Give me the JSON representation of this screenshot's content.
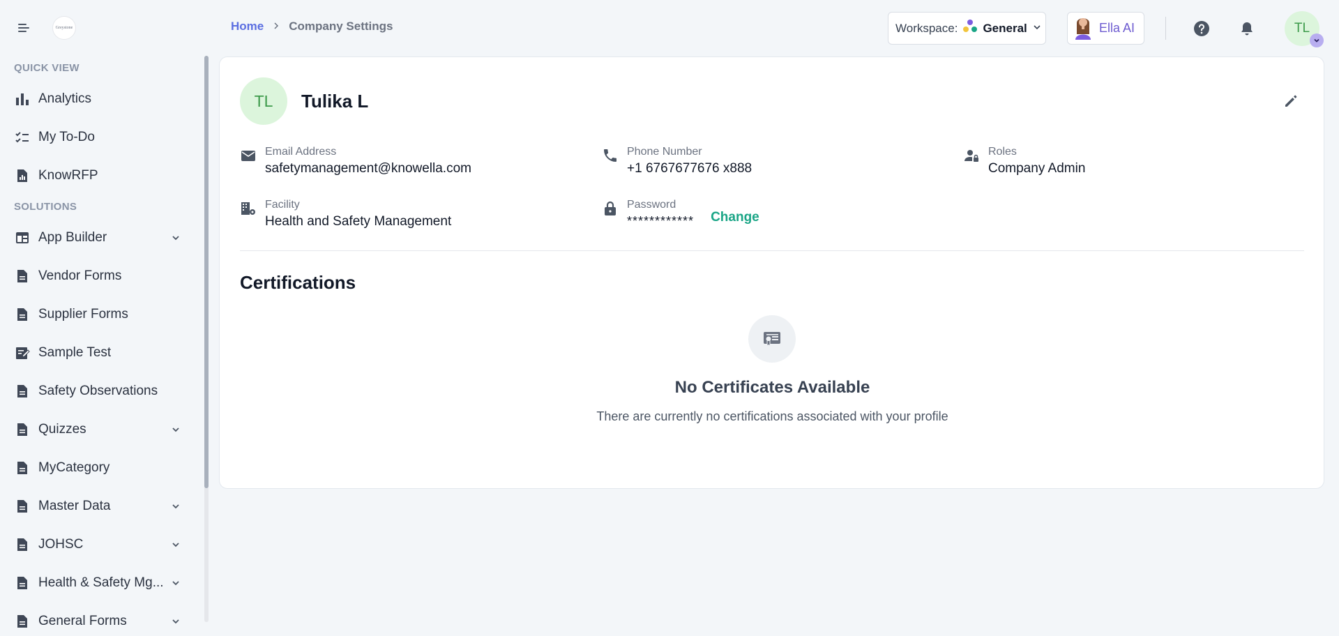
{
  "brand": {
    "logo_text": "Greystone"
  },
  "sidebar": {
    "sections": [
      {
        "title": "QUICK VIEW"
      },
      {
        "title": "SOLUTIONS"
      }
    ],
    "quick_view": [
      {
        "label": "Analytics",
        "icon": "bar-chart-icon"
      },
      {
        "label": "My To-Do",
        "icon": "checklist-icon"
      },
      {
        "label": "KnowRFP",
        "icon": "document-chart-icon"
      }
    ],
    "solutions": [
      {
        "label": "App Builder",
        "icon": "app-builder-icon",
        "expandable": true
      },
      {
        "label": "Vendor Forms",
        "icon": "document-icon",
        "expandable": false
      },
      {
        "label": "Supplier Forms",
        "icon": "document-icon",
        "expandable": false
      },
      {
        "label": "Sample Test",
        "icon": "edit-document-icon",
        "expandable": false
      },
      {
        "label": "Safety Observations",
        "icon": "document-icon",
        "expandable": false
      },
      {
        "label": "Quizzes",
        "icon": "document-icon",
        "expandable": true
      },
      {
        "label": "MyCategory",
        "icon": "document-icon",
        "expandable": false
      },
      {
        "label": "Master Data",
        "icon": "document-icon",
        "expandable": true
      },
      {
        "label": "JOHSC",
        "icon": "document-icon",
        "expandable": true
      },
      {
        "label": "Health & Safety Mg...",
        "icon": "document-icon",
        "expandable": true
      },
      {
        "label": "General Forms",
        "icon": "document-icon",
        "expandable": true
      }
    ]
  },
  "header": {
    "breadcrumb": {
      "home": "Home",
      "current": "Company Settings"
    },
    "workspace": {
      "label": "Workspace:",
      "value": "General"
    },
    "assistant": {
      "label": "Ella AI"
    },
    "user_initials": "TL"
  },
  "profile": {
    "initials": "TL",
    "name": "Tulika L",
    "fields": {
      "email": {
        "label": "Email Address",
        "value": "safetymanagement@knowella.com"
      },
      "phone": {
        "label": "Phone Number",
        "value": "+1 6767677676 x888"
      },
      "roles": {
        "label": "Roles",
        "value": "Company Admin"
      },
      "facility": {
        "label": "Facility",
        "value": "Health and Safety Management"
      },
      "password": {
        "label": "Password",
        "value": "************",
        "action": "Change"
      }
    }
  },
  "certifications": {
    "title": "Certifications",
    "empty_title": "No Certificates Available",
    "empty_message": "There are currently no certifications associated with your profile"
  },
  "colors": {
    "accent": "#5b6ee1",
    "success": "#1aa586",
    "avatar_bg": "#dcf5dc",
    "background": "#f3f6f9"
  }
}
